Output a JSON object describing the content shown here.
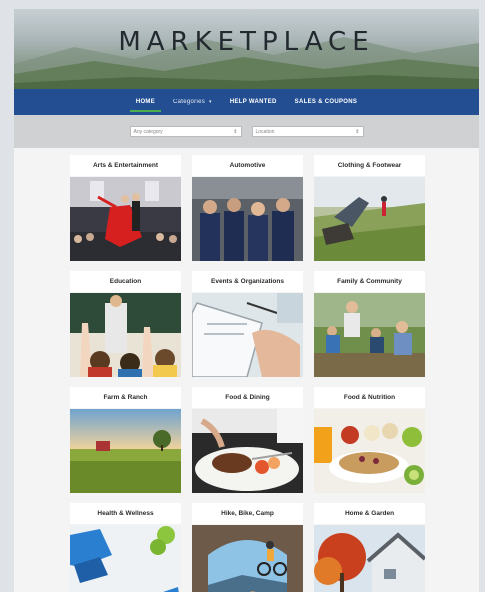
{
  "hero": {
    "title": "MARKETPLACE"
  },
  "nav": {
    "items": [
      {
        "label": "HOME",
        "active": true
      },
      {
        "label": "Categories",
        "has_dropdown": true
      },
      {
        "label": "HELP WANTED"
      },
      {
        "label": "SALES & COUPONS"
      }
    ]
  },
  "filters": {
    "category": "Any category",
    "location": "Location"
  },
  "categories": [
    {
      "label": "Arts & Entertainment",
      "image": "dancers-on-stage"
    },
    {
      "label": "Automotive",
      "image": "mechanics-team"
    },
    {
      "label": "Clothing & Footwear",
      "image": "hiking-boots"
    },
    {
      "label": "Education",
      "image": "classroom-hands-raised"
    },
    {
      "label": "Events & Organizations",
      "image": "clipboard-writing"
    },
    {
      "label": "Family & Community",
      "image": "family-outdoors"
    },
    {
      "label": "Farm & Ranch",
      "image": "farm-field"
    },
    {
      "label": "Food & Dining",
      "image": "plated-meal"
    },
    {
      "label": "Food & Nutrition",
      "image": "healthy-breakfast"
    },
    {
      "label": "Health & Wellness",
      "image": "sneakers-apples"
    },
    {
      "label": "Hike, Bike, Camp",
      "image": "mountain-biker-arch"
    },
    {
      "label": "Home & Garden",
      "image": "house-autumn-tree"
    }
  ]
}
